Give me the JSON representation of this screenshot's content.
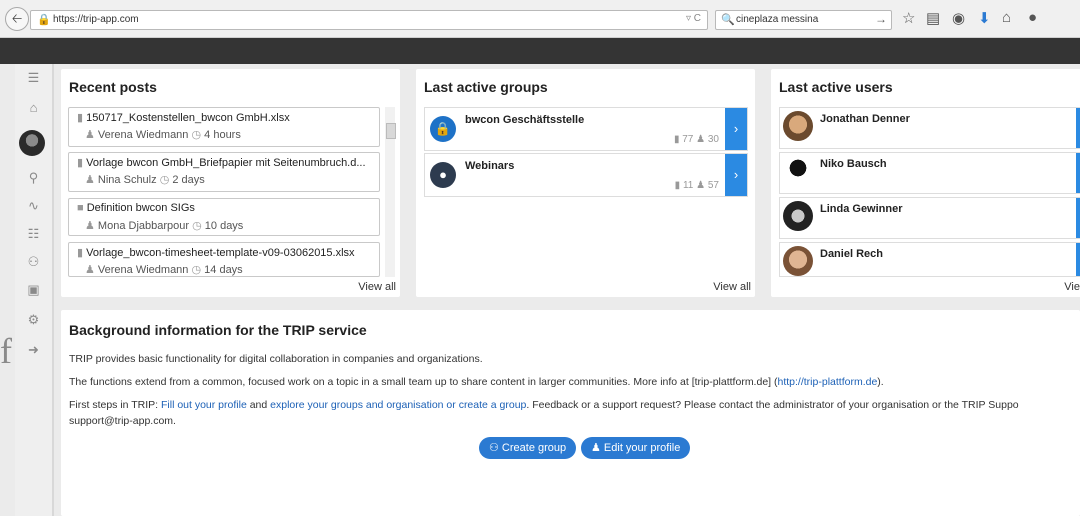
{
  "browser": {
    "url": "https://trip-app.com",
    "search_value": "cineplaza messina"
  },
  "recent_posts": {
    "title": "Recent posts",
    "view_all": "View all",
    "items": [
      {
        "title": "150717_Kostenstellen_bwcon GmbH.xlsx",
        "author": "Verena Wiedmann",
        "time": "4 hours",
        "kind": "file"
      },
      {
        "title": "Vorlage bwcon GmbH_Briefpapier mit Seitenumbruch.d...",
        "author": "Nina Schulz",
        "time": "2 days",
        "kind": "file"
      },
      {
        "title": "Definition bwcon SIGs",
        "author": "Mona Djabbarpour",
        "time": "10 days",
        "kind": "comment"
      },
      {
        "title": "Vorlage_bwcon-timesheet-template-v09-03062015.xlsx",
        "author": "Verena Wiedmann",
        "time": "14 days",
        "kind": "file"
      }
    ]
  },
  "groups": {
    "title": "Last active groups",
    "view_all": "View all",
    "items": [
      {
        "name": "bwcon Geschäftsstelle",
        "files": "77",
        "members": "30"
      },
      {
        "name": "Webinars",
        "files": "11",
        "members": "57"
      }
    ]
  },
  "users": {
    "title": "Last active users",
    "view_all": "Vie",
    "items": [
      {
        "name": "Jonathan Denner"
      },
      {
        "name": "Niko Bausch"
      },
      {
        "name": "Linda Gewinner"
      },
      {
        "name": "Daniel Rech"
      }
    ]
  },
  "background": {
    "title": "Background information for the TRIP service",
    "p1": "TRIP provides basic functionality for digital collaboration in companies and organizations.",
    "p2_a": "The functions extend from a common, focused work on a topic in a small team up to share content in larger communities. More info at [trip-plattform.de] (",
    "p2_link": "http://trip-plattform.de",
    "p2_b": ").",
    "p3_a": "First steps in TRIP: ",
    "p3_link1": "Fill out your profile",
    "p3_b": " and ",
    "p3_link2": "explore your groups and organisation or create a group",
    "p3_c": ". Feedback or a support request? Please contact the administrator of your organisation or the TRIP Suppo",
    "p4": "support@trip-app.com.",
    "create_group": "Create group",
    "edit_profile": "Edit your profile"
  }
}
